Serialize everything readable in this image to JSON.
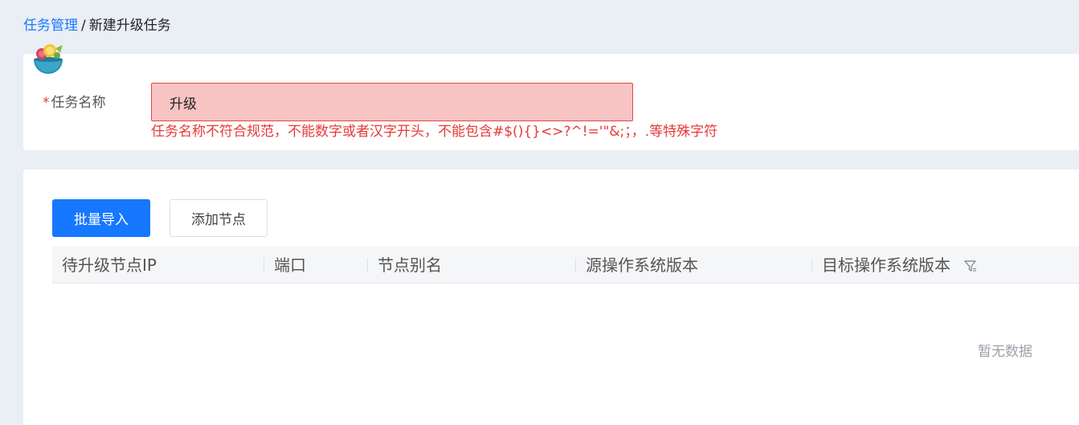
{
  "breadcrumb": {
    "parent": "任务管理",
    "separator": "/",
    "current": "新建升级任务"
  },
  "form": {
    "required_mark": "*",
    "task_name_label": "任务名称",
    "task_name_value": "升级",
    "error_message": "任务名称不符合规范，不能数字或者汉字开头，不能包含#$(){}<>?^!='\"&;；，.等特殊字符"
  },
  "toolbar": {
    "import_label": "批量导入",
    "add_node_label": "添加节点"
  },
  "table": {
    "columns": [
      "待升级节点IP",
      "端口",
      "节点别名",
      "源操作系统版本",
      "目标操作系统版本"
    ],
    "empty_text": "暂无数据"
  },
  "colors": {
    "primary": "#1677ff",
    "error": "#e53935",
    "error_bg": "#f8c3c3"
  }
}
